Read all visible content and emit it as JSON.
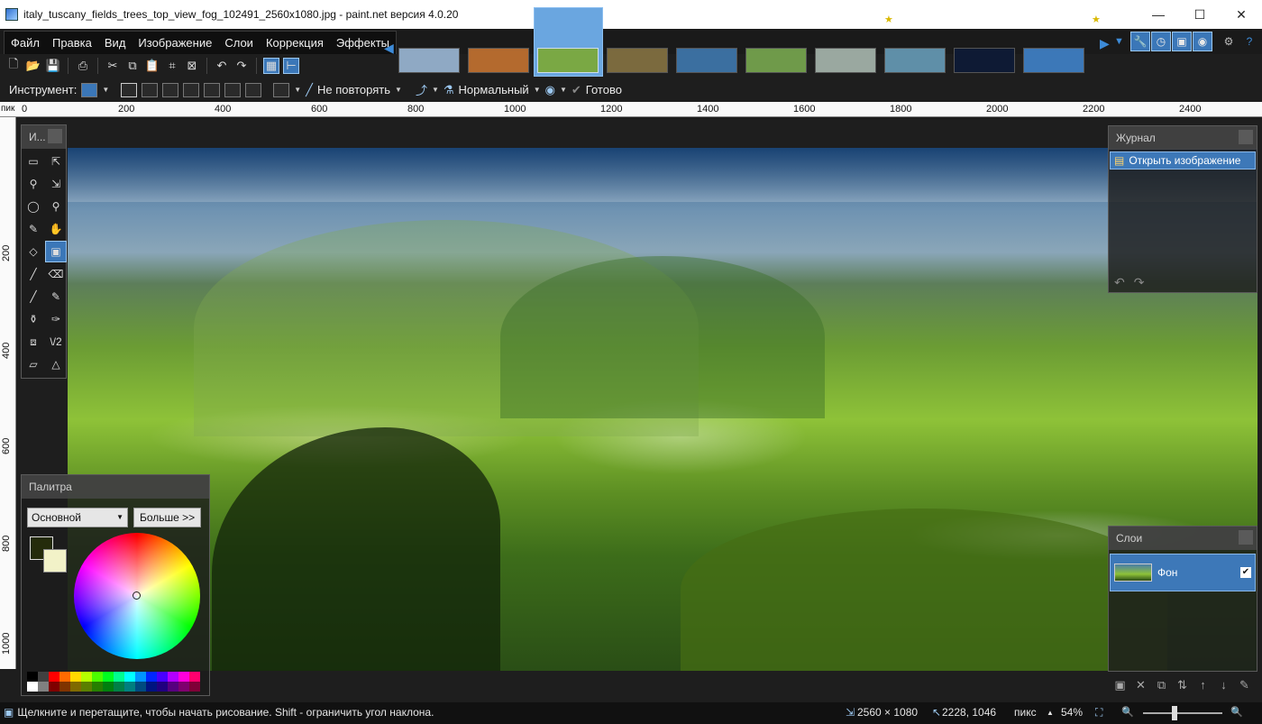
{
  "window": {
    "title": "italy_tuscany_fields_trees_top_view_fog_102491_2560x1080.jpg - paint.net версия 4.0.20",
    "min_glyph": "—",
    "max_glyph": "☐",
    "close_glyph": "✕"
  },
  "menu": [
    "Файл",
    "Правка",
    "Вид",
    "Изображение",
    "Слои",
    "Коррекция",
    "Эффекты"
  ],
  "tabs": {
    "prev_glyph": "◀",
    "next_glyph": "▶",
    "dropdown_glyph": "▼",
    "star_glyph": "★",
    "thumb_colors": [
      "#8fa9c4",
      "#b46a2e",
      "#7aa844",
      "#7b6a3e",
      "#3b6fa0",
      "#6f9a4a",
      "#9aa8a0",
      "#5f8fa8",
      "#0e1a34",
      "#3c78b8"
    ]
  },
  "toolbar2": {
    "tool_label": "Инструмент:",
    "repeat_label": "Не повторять",
    "blend_label": "Нормальный",
    "done_label": "Готово",
    "done_glyph": "✔"
  },
  "ruler": {
    "unit": "пик",
    "h_ticks": [
      "0",
      "200",
      "400",
      "600",
      "800",
      "1000",
      "1200",
      "1400",
      "1600",
      "1800",
      "2000",
      "2200",
      "2400"
    ],
    "v_ticks": [
      "200",
      "400",
      "600",
      "800",
      "1000"
    ]
  },
  "tools_panel": {
    "title": "И...",
    "tools": [
      "▭",
      "⇱",
      "⚲",
      "⇲",
      "◯",
      "⚲",
      "✎",
      "✋",
      "◇",
      "▣",
      "╱",
      "⌫",
      "╱",
      "✎",
      "⚱",
      "✑",
      "⧈",
      "\\/2",
      "▱",
      "△"
    ]
  },
  "history_panel": {
    "title": "Журнал",
    "items": [
      "Открыть изображение"
    ],
    "undo_glyph": "↶",
    "redo_glyph": "↷"
  },
  "layers_panel": {
    "title": "Слои",
    "layers": [
      {
        "name": "Фон",
        "visible": "✔"
      }
    ],
    "toolbar_glyphs": [
      "▣",
      "✕",
      "⧉",
      "⇅",
      "↑",
      "↓",
      "✎"
    ]
  },
  "palette_panel": {
    "title": "Палитра",
    "mode": "Основной",
    "more_label": "Больше >>",
    "dd_glyph": "▼",
    "primary_color": "#242b0b",
    "secondary_color": "#f2f2c8",
    "swatches_row1": [
      "#000000",
      "#404040",
      "#ff0000",
      "#ff6a00",
      "#ffd800",
      "#b6ff00",
      "#4cff00",
      "#00ff21",
      "#00ff90",
      "#00ffff",
      "#0094ff",
      "#0026ff",
      "#4800ff",
      "#b200ff",
      "#ff00dc",
      "#ff006e"
    ],
    "swatches_row2": [
      "#ffffff",
      "#808080",
      "#7f0000",
      "#7f3300",
      "#7f6a00",
      "#5b7f00",
      "#267f00",
      "#007f0e",
      "#007f46",
      "#007f7f",
      "#004a7f",
      "#00137f",
      "#21007f",
      "#57007f",
      "#7f006e",
      "#7f0037"
    ]
  },
  "status": {
    "hint": "Щелкните и перетащите, чтобы начать рисование. Shift - ограничить угол наклона.",
    "image_size": "2560 × 1080",
    "cursor_pos": "2228, 1046",
    "units": "пикс",
    "units_caret": "▲",
    "zoom": "54%",
    "fit_glyph": "⛶",
    "zoom_out_glyph": "🔍",
    "zoom_in_glyph": "🔍"
  }
}
